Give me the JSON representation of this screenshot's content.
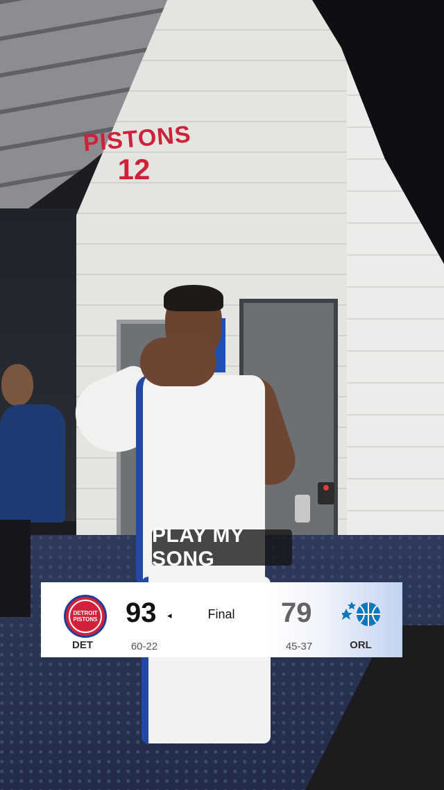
{
  "caption": "PLAY MY SONG",
  "jersey": {
    "wordmark": "PISTONS",
    "number": "12"
  },
  "scoreboard": {
    "status": "Final",
    "home": {
      "abbr": "DET",
      "logo_text": "DETROIT PISTONS",
      "score": "93",
      "record": "60-22",
      "winner_indicator": "◂",
      "color": "#d3213c"
    },
    "away": {
      "abbr": "ORL",
      "score": "79",
      "record": "45-37",
      "color": "#0b77bd"
    }
  }
}
